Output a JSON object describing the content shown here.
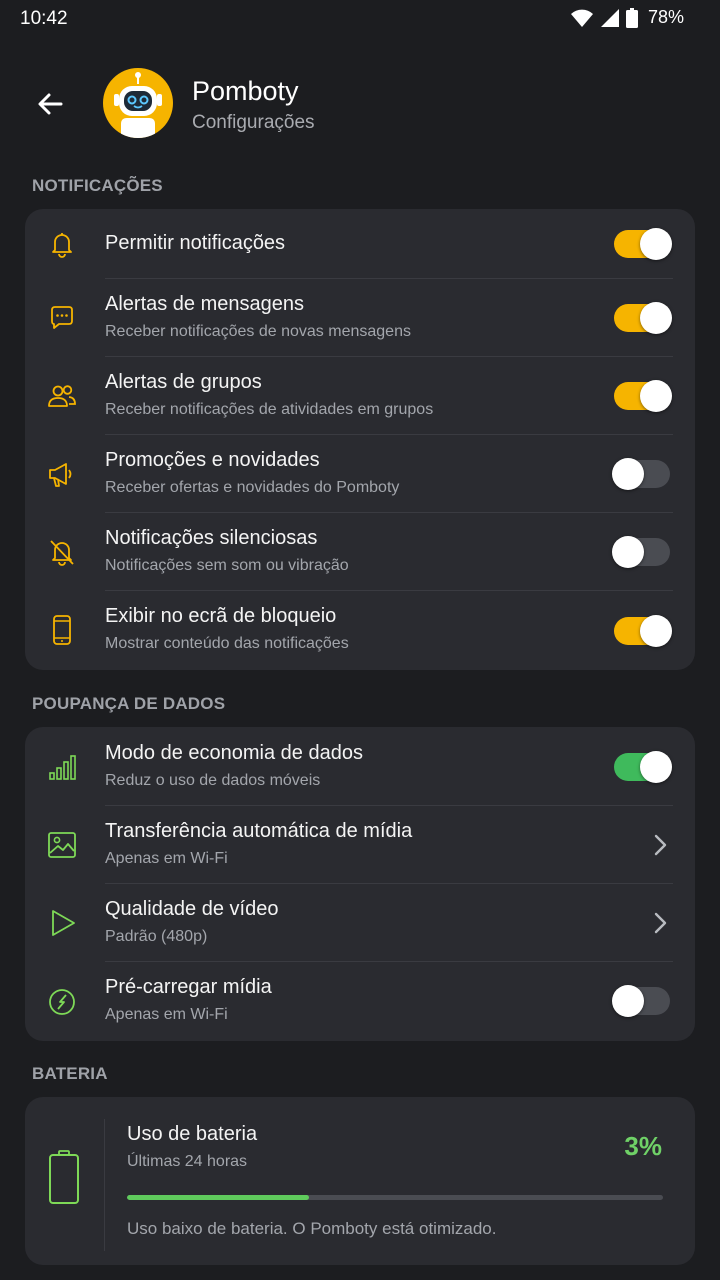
{
  "status_bar": {
    "time": "10:42",
    "battery": "78%"
  },
  "header": {
    "title": "Pomboty",
    "subtitle": "Configurações"
  },
  "sections": {
    "notifications": "NOTIFICAÇÕES",
    "data_saver": "POUPANÇA DE DADOS",
    "battery": "BATERIA"
  },
  "notifications": [
    {
      "icon": "bell-icon",
      "title": "Permitir notificações",
      "subtitle": "",
      "state": "on"
    },
    {
      "icon": "chat-bubble-icon",
      "title": "Alertas de mensagens",
      "subtitle": "Receber notificações de novas mensagens",
      "state": "on"
    },
    {
      "icon": "group-icon",
      "title": "Alertas de grupos",
      "subtitle": "Receber notificações de atividades em grupos",
      "state": "on"
    },
    {
      "icon": "megaphone-icon",
      "title": "Promoções e novidades",
      "subtitle": "Receber ofertas e novidades do Pomboty",
      "state": "off"
    },
    {
      "icon": "bell-off-icon",
      "title": "Notificações silenciosas",
      "subtitle": "Notificações sem som ou vibração",
      "state": "off"
    },
    {
      "icon": "phone-icon",
      "title": "Exibir no ecrã de bloqueio",
      "subtitle": "Mostrar conteúdo das notificações",
      "state": "on"
    }
  ],
  "data_saver": [
    {
      "icon": "signal-bars-icon",
      "title": "Modo de economia de dados",
      "subtitle": "Reduz o uso de dados móveis",
      "state": "on"
    },
    {
      "icon": "image-icon",
      "title": "Transferência automática de mídia",
      "subtitle": "Apenas em Wi-Fi",
      "control": "chevron"
    },
    {
      "icon": "play-icon",
      "title": "Qualidade de vídeo",
      "subtitle": "Padrão (480p)",
      "control": "chevron"
    },
    {
      "icon": "preload-icon",
      "title": "Pré-carregar mídia",
      "subtitle": "Apenas em Wi-Fi",
      "state": "off"
    }
  ],
  "battery": {
    "title": "Uso de bateria",
    "subtitle": "Últimas 24 horas",
    "percent": "3%",
    "bar_fraction": 0.34,
    "note": "Uso baixo de bateria. O Pomboty está otimizado."
  },
  "colors": {
    "accent_notifications": "#f6b400",
    "accent_data": "#7ed957",
    "toggle_on_data": "#3fba5c",
    "background": "#1c1d20",
    "card": "#2a2b30"
  }
}
